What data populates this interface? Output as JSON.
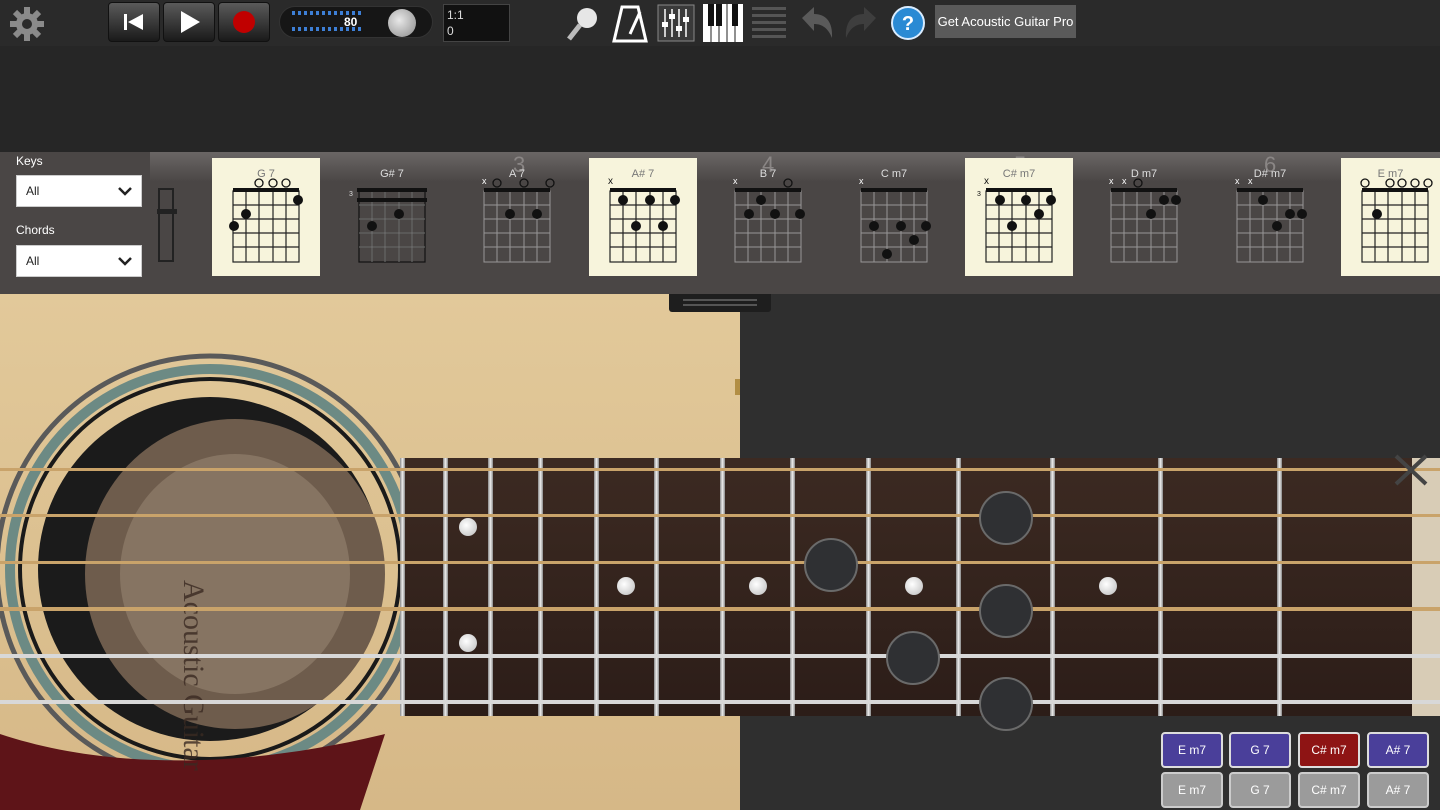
{
  "toolbar": {
    "icons": [
      "gear-icon",
      "rewind-icon",
      "play-icon",
      "record-icon",
      "magnifier-icon",
      "metronome-icon",
      "mixer-icon",
      "piano-icon",
      "list-icon",
      "undo-icon",
      "redo-icon",
      "help-icon"
    ],
    "tempo": "80",
    "position_line1": "1:1",
    "position_line2": "0",
    "pro_button": "Get Acoustic Guitar Pro"
  },
  "filters": {
    "keys_label": "Keys",
    "keys_value": "All",
    "chords_label": "Chords",
    "chords_value": "All"
  },
  "chord_strip": {
    "ruler_numbers": [
      "3",
      "4",
      "5",
      "6"
    ],
    "chords": [
      {
        "name": "G 7",
        "highlighted": true
      },
      {
        "name": "G# 7",
        "highlighted": false
      },
      {
        "name": "A 7",
        "highlighted": false
      },
      {
        "name": "A# 7",
        "highlighted": true
      },
      {
        "name": "B 7",
        "highlighted": false
      },
      {
        "name": "C m7",
        "highlighted": false
      },
      {
        "name": "C# m7",
        "highlighted": true
      },
      {
        "name": "D m7",
        "highlighted": false
      },
      {
        "name": "D# m7",
        "highlighted": false
      },
      {
        "name": "E m7",
        "highlighted": true
      }
    ]
  },
  "guitar": {
    "body_text": "Acoustic Guitar"
  },
  "chord_buttons": {
    "top": [
      {
        "label": "E m7",
        "style": "purple"
      },
      {
        "label": "G 7",
        "style": "purple"
      },
      {
        "label": "C# m7",
        "style": "red"
      },
      {
        "label": "A# 7",
        "style": "purple"
      }
    ],
    "bottom": [
      {
        "label": "E m7",
        "style": "gray"
      },
      {
        "label": "G 7",
        "style": "gray"
      },
      {
        "label": "C# m7",
        "style": "gray"
      },
      {
        "label": "A# 7",
        "style": "gray"
      }
    ]
  },
  "colors": {
    "accent_purple": "#4a3f9a",
    "accent_red": "#8e1414",
    "highlight_card": "#f7f4dc"
  }
}
